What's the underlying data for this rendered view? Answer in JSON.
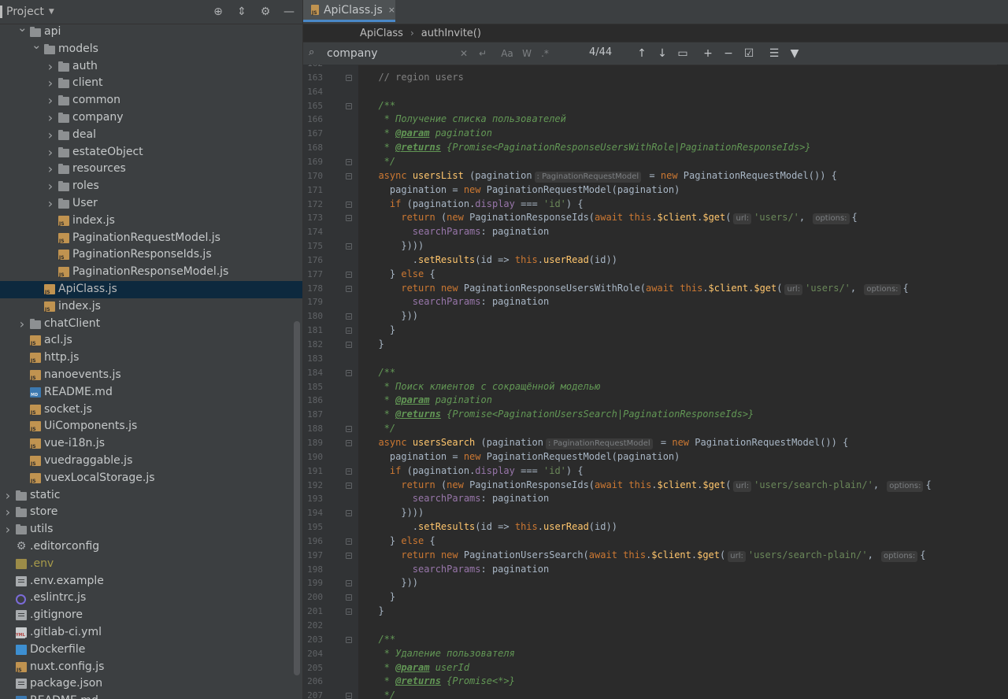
{
  "sidebar": {
    "title": "Project",
    "tools": {
      "locate": "⊕",
      "collapse": "⇕",
      "settings": "⚙",
      "hide": "—"
    },
    "tree": [
      {
        "label": "api",
        "type": "folder",
        "indent": 1,
        "arrow": "v"
      },
      {
        "label": "models",
        "type": "folder",
        "indent": 2,
        "arrow": "v"
      },
      {
        "label": "auth",
        "type": "folder",
        "indent": 3,
        "arrow": ">"
      },
      {
        "label": "client",
        "type": "folder",
        "indent": 3,
        "arrow": ">"
      },
      {
        "label": "common",
        "type": "folder",
        "indent": 3,
        "arrow": ">"
      },
      {
        "label": "company",
        "type": "folder",
        "indent": 3,
        "arrow": ">"
      },
      {
        "label": "deal",
        "type": "folder",
        "indent": 3,
        "arrow": ">"
      },
      {
        "label": "estateObject",
        "type": "folder",
        "indent": 3,
        "arrow": ">"
      },
      {
        "label": "resources",
        "type": "folder",
        "indent": 3,
        "arrow": ">"
      },
      {
        "label": "roles",
        "type": "folder",
        "indent": 3,
        "arrow": ">"
      },
      {
        "label": "User",
        "type": "folder",
        "indent": 3,
        "arrow": ">"
      },
      {
        "label": "index.js",
        "type": "js",
        "indent": 3
      },
      {
        "label": "PaginationRequestModel.js",
        "type": "js",
        "indent": 3
      },
      {
        "label": "PaginationResponseIds.js",
        "type": "js",
        "indent": 3
      },
      {
        "label": "PaginationResponseModel.js",
        "type": "js",
        "indent": 3
      },
      {
        "label": "ApiClass.js",
        "type": "js",
        "indent": 2,
        "selected": true
      },
      {
        "label": "index.js",
        "type": "js",
        "indent": 2
      },
      {
        "label": "chatClient",
        "type": "folder",
        "indent": 1,
        "arrow": ">"
      },
      {
        "label": "acl.js",
        "type": "js",
        "indent": 1
      },
      {
        "label": "http.js",
        "type": "js",
        "indent": 1
      },
      {
        "label": "nanoevents.js",
        "type": "js",
        "indent": 1
      },
      {
        "label": "README.md",
        "type": "md",
        "indent": 1
      },
      {
        "label": "socket.js",
        "type": "js",
        "indent": 1
      },
      {
        "label": "UiComponents.js",
        "type": "js",
        "indent": 1
      },
      {
        "label": "vue-i18n.js",
        "type": "js",
        "indent": 1
      },
      {
        "label": "vuedraggable.js",
        "type": "js",
        "indent": 1
      },
      {
        "label": "vuexLocalStorage.js",
        "type": "js",
        "indent": 1
      },
      {
        "label": "static",
        "type": "folder",
        "indent": 0,
        "arrow": ">"
      },
      {
        "label": "store",
        "type": "folder",
        "indent": 0,
        "arrow": ">"
      },
      {
        "label": "utils",
        "type": "folder",
        "indent": 0,
        "arrow": ">"
      },
      {
        "label": ".editorconfig",
        "type": "gear",
        "indent": 0
      },
      {
        "label": ".env",
        "type": "env",
        "indent": 0
      },
      {
        "label": ".env.example",
        "type": "plain",
        "indent": 0
      },
      {
        "label": ".eslintrc.js",
        "type": "eslint",
        "indent": 0
      },
      {
        "label": ".gitignore",
        "type": "plain",
        "indent": 0
      },
      {
        "label": ".gitlab-ci.yml",
        "type": "yml",
        "indent": 0
      },
      {
        "label": "Dockerfile",
        "type": "docker",
        "indent": 0
      },
      {
        "label": "nuxt.config.js",
        "type": "js",
        "indent": 0
      },
      {
        "label": "package.json",
        "type": "plain",
        "indent": 0
      },
      {
        "label": "README.md",
        "type": "md",
        "indent": 0
      }
    ]
  },
  "editor": {
    "tab": {
      "label": "ApiClass.js",
      "close": "×"
    },
    "breadcrumb": [
      "ApiClass",
      "authInvite()"
    ],
    "find": {
      "query": "company",
      "count": "4/44",
      "options": {
        "clear": "✕",
        "newline": "↵",
        "match_case": "Aa",
        "words": "W",
        "regex": ".*"
      },
      "nav": {
        "prev": "↑",
        "next": "↓",
        "context": "▭",
        "add": "+",
        "remove": "−",
        "select_all": "☑",
        "multiline": "☰",
        "filter": "▼"
      }
    },
    "code": [
      {
        "n": "162",
        "t": []
      },
      {
        "n": "163",
        "fold": true,
        "t": [
          [
            "  ",
            ""
          ],
          [
            "// region users",
            "cm"
          ]
        ]
      },
      {
        "n": "164",
        "t": []
      },
      {
        "n": "165",
        "fold": true,
        "t": [
          [
            "  ",
            ""
          ],
          [
            "/**",
            "dc"
          ]
        ]
      },
      {
        "n": "166",
        "t": [
          [
            "   * Получение списка пользователей",
            "dc"
          ]
        ]
      },
      {
        "n": "167",
        "t": [
          [
            "   * ",
            "dc"
          ],
          [
            "@param",
            "tg"
          ],
          [
            " pagination",
            "dc"
          ]
        ]
      },
      {
        "n": "168",
        "t": [
          [
            "   * ",
            "dc"
          ],
          [
            "@returns",
            "tg"
          ],
          [
            " {Promise<PaginationResponseUsersWithRole|PaginationResponseIds>}",
            "dc"
          ]
        ]
      },
      {
        "n": "169",
        "fold": true,
        "t": [
          [
            "   */",
            "dc"
          ]
        ]
      },
      {
        "n": "170",
        "fold": true,
        "t": [
          [
            "  ",
            ""
          ],
          [
            "async ",
            "kw"
          ],
          [
            "usersList",
            "fn"
          ],
          [
            " (pagination",
            ""
          ],
          [
            ": PaginationRequestModel",
            "hint"
          ],
          [
            " = ",
            ""
          ],
          [
            "new ",
            "kw"
          ],
          [
            "PaginationRequestModel()) {",
            ""
          ]
        ]
      },
      {
        "n": "171",
        "t": [
          [
            "    pagination = ",
            ""
          ],
          [
            "new ",
            "kw"
          ],
          [
            "PaginationRequestModel(pagination)",
            ""
          ]
        ]
      },
      {
        "n": "172",
        "fold": true,
        "t": [
          [
            "    ",
            ""
          ],
          [
            "if ",
            "kw"
          ],
          [
            "(pagination.",
            ""
          ],
          [
            "display",
            "pr"
          ],
          [
            " === ",
            ""
          ],
          [
            "'id'",
            "st"
          ],
          [
            ") {",
            ""
          ]
        ]
      },
      {
        "n": "173",
        "fold": true,
        "t": [
          [
            "      ",
            ""
          ],
          [
            "return ",
            "kw"
          ],
          [
            "(",
            ""
          ],
          [
            "new ",
            "kw"
          ],
          [
            "PaginationResponseIds(",
            ""
          ],
          [
            "await ",
            "kw"
          ],
          [
            "this",
            "kw"
          ],
          [
            ".",
            ""
          ],
          [
            "$client",
            "fn"
          ],
          [
            ".",
            ""
          ],
          [
            "$get",
            "fn"
          ],
          [
            "(",
            ""
          ],
          [
            "url:",
            "hint"
          ],
          [
            "'users/'",
            "st"
          ],
          [
            ", ",
            ""
          ],
          [
            "options:",
            "hint"
          ],
          [
            "{",
            ""
          ]
        ]
      },
      {
        "n": "174",
        "t": [
          [
            "        ",
            ""
          ],
          [
            "searchParams",
            "pr"
          ],
          [
            ": pagination",
            ""
          ]
        ]
      },
      {
        "n": "175",
        "fold": true,
        "t": [
          [
            "      })))",
            ""
          ]
        ]
      },
      {
        "n": "176",
        "t": [
          [
            "        .",
            ""
          ],
          [
            "setResults",
            "fn"
          ],
          [
            "(id => ",
            ""
          ],
          [
            "this",
            "kw"
          ],
          [
            ".",
            ""
          ],
          [
            "userRead",
            "fn"
          ],
          [
            "(id))",
            ""
          ]
        ]
      },
      {
        "n": "177",
        "fold": true,
        "t": [
          [
            "    } ",
            ""
          ],
          [
            "else ",
            "kw"
          ],
          [
            "{",
            ""
          ]
        ]
      },
      {
        "n": "178",
        "fold": true,
        "t": [
          [
            "      ",
            ""
          ],
          [
            "return ",
            "kw"
          ],
          [
            "new ",
            "kw"
          ],
          [
            "PaginationResponseUsersWithRole(",
            ""
          ],
          [
            "await ",
            "kw"
          ],
          [
            "this",
            "kw"
          ],
          [
            ".",
            ""
          ],
          [
            "$client",
            "fn"
          ],
          [
            ".",
            ""
          ],
          [
            "$get",
            "fn"
          ],
          [
            "(",
            ""
          ],
          [
            "url:",
            "hint"
          ],
          [
            "'users/'",
            "st"
          ],
          [
            ", ",
            ""
          ],
          [
            "options:",
            "hint"
          ],
          [
            "{",
            ""
          ]
        ]
      },
      {
        "n": "179",
        "t": [
          [
            "        ",
            ""
          ],
          [
            "searchParams",
            "pr"
          ],
          [
            ": pagination",
            ""
          ]
        ]
      },
      {
        "n": "180",
        "fold": true,
        "t": [
          [
            "      }))",
            ""
          ]
        ]
      },
      {
        "n": "181",
        "fold": true,
        "t": [
          [
            "    }",
            ""
          ]
        ]
      },
      {
        "n": "182",
        "fold": true,
        "t": [
          [
            "  }",
            ""
          ]
        ]
      },
      {
        "n": "183",
        "t": []
      },
      {
        "n": "184",
        "fold": true,
        "t": [
          [
            "  ",
            ""
          ],
          [
            "/**",
            "dc"
          ]
        ]
      },
      {
        "n": "185",
        "t": [
          [
            "   * Поиск клиентов с сокращённой моделью",
            "dc"
          ]
        ]
      },
      {
        "n": "186",
        "t": [
          [
            "   * ",
            "dc"
          ],
          [
            "@param",
            "tg"
          ],
          [
            " pagination",
            "dc"
          ]
        ]
      },
      {
        "n": "187",
        "t": [
          [
            "   * ",
            "dc"
          ],
          [
            "@returns",
            "tg"
          ],
          [
            " {Promise<PaginationUsersSearch|PaginationResponseIds>}",
            "dc"
          ]
        ]
      },
      {
        "n": "188",
        "fold": true,
        "t": [
          [
            "   */",
            "dc"
          ]
        ]
      },
      {
        "n": "189",
        "fold": true,
        "t": [
          [
            "  ",
            ""
          ],
          [
            "async ",
            "kw"
          ],
          [
            "usersSearch",
            "fn"
          ],
          [
            " (pagination",
            ""
          ],
          [
            ": PaginationRequestModel",
            "hint"
          ],
          [
            " = ",
            ""
          ],
          [
            "new ",
            "kw"
          ],
          [
            "PaginationRequestModel()) {",
            ""
          ]
        ]
      },
      {
        "n": "190",
        "t": [
          [
            "    pagination = ",
            ""
          ],
          [
            "new ",
            "kw"
          ],
          [
            "PaginationRequestModel(pagination)",
            ""
          ]
        ]
      },
      {
        "n": "191",
        "fold": true,
        "t": [
          [
            "    ",
            ""
          ],
          [
            "if ",
            "kw"
          ],
          [
            "(pagination.",
            ""
          ],
          [
            "display",
            "pr"
          ],
          [
            " === ",
            ""
          ],
          [
            "'id'",
            "st"
          ],
          [
            ") {",
            ""
          ]
        ]
      },
      {
        "n": "192",
        "fold": true,
        "t": [
          [
            "      ",
            ""
          ],
          [
            "return ",
            "kw"
          ],
          [
            "(",
            ""
          ],
          [
            "new ",
            "kw"
          ],
          [
            "PaginationResponseIds(",
            ""
          ],
          [
            "await ",
            "kw"
          ],
          [
            "this",
            "kw"
          ],
          [
            ".",
            ""
          ],
          [
            "$client",
            "fn"
          ],
          [
            ".",
            ""
          ],
          [
            "$get",
            "fn"
          ],
          [
            "(",
            ""
          ],
          [
            "url:",
            "hint"
          ],
          [
            "'users/search-plain/'",
            "st"
          ],
          [
            ", ",
            ""
          ],
          [
            "options:",
            "hint"
          ],
          [
            "{",
            ""
          ]
        ]
      },
      {
        "n": "193",
        "t": [
          [
            "        ",
            ""
          ],
          [
            "searchParams",
            "pr"
          ],
          [
            ": pagination",
            ""
          ]
        ]
      },
      {
        "n": "194",
        "fold": true,
        "t": [
          [
            "      })))",
            ""
          ]
        ]
      },
      {
        "n": "195",
        "t": [
          [
            "        .",
            ""
          ],
          [
            "setResults",
            "fn"
          ],
          [
            "(id => ",
            ""
          ],
          [
            "this",
            "kw"
          ],
          [
            ".",
            ""
          ],
          [
            "userRead",
            "fn"
          ],
          [
            "(id))",
            ""
          ]
        ]
      },
      {
        "n": "196",
        "fold": true,
        "t": [
          [
            "    } ",
            ""
          ],
          [
            "else ",
            "kw"
          ],
          [
            "{",
            ""
          ]
        ]
      },
      {
        "n": "197",
        "fold": true,
        "t": [
          [
            "      ",
            ""
          ],
          [
            "return ",
            "kw"
          ],
          [
            "new ",
            "kw"
          ],
          [
            "PaginationUsersSearch(",
            ""
          ],
          [
            "await ",
            "kw"
          ],
          [
            "this",
            "kw"
          ],
          [
            ".",
            ""
          ],
          [
            "$client",
            "fn"
          ],
          [
            ".",
            ""
          ],
          [
            "$get",
            "fn"
          ],
          [
            "(",
            ""
          ],
          [
            "url:",
            "hint"
          ],
          [
            "'users/search-plain/'",
            "st"
          ],
          [
            ", ",
            ""
          ],
          [
            "options:",
            "hint"
          ],
          [
            "{",
            ""
          ]
        ]
      },
      {
        "n": "198",
        "t": [
          [
            "        ",
            ""
          ],
          [
            "searchParams",
            "pr"
          ],
          [
            ": pagination",
            ""
          ]
        ]
      },
      {
        "n": "199",
        "fold": true,
        "t": [
          [
            "      }))",
            ""
          ]
        ]
      },
      {
        "n": "200",
        "fold": true,
        "t": [
          [
            "    }",
            ""
          ]
        ]
      },
      {
        "n": "201",
        "fold": true,
        "t": [
          [
            "  }",
            ""
          ]
        ]
      },
      {
        "n": "202",
        "t": []
      },
      {
        "n": "203",
        "fold": true,
        "t": [
          [
            "  ",
            ""
          ],
          [
            "/**",
            "dc"
          ]
        ]
      },
      {
        "n": "204",
        "t": [
          [
            "   * Удаление пользователя",
            "dc"
          ]
        ]
      },
      {
        "n": "205",
        "t": [
          [
            "   * ",
            "dc"
          ],
          [
            "@param",
            "tg"
          ],
          [
            " userId",
            "dc"
          ]
        ]
      },
      {
        "n": "206",
        "t": [
          [
            "   * ",
            "dc"
          ],
          [
            "@returns",
            "tg"
          ],
          [
            " {Promise<*>}",
            "dc"
          ]
        ]
      },
      {
        "n": "207",
        "fold": true,
        "t": [
          [
            "   */",
            "dc"
          ]
        ]
      }
    ]
  },
  "colors": {
    "accent": "#4a88c7",
    "selection": "#0d293e",
    "keyword": "#cc7832",
    "function": "#ffc66d",
    "string": "#6a8759",
    "doc": "#629755"
  }
}
